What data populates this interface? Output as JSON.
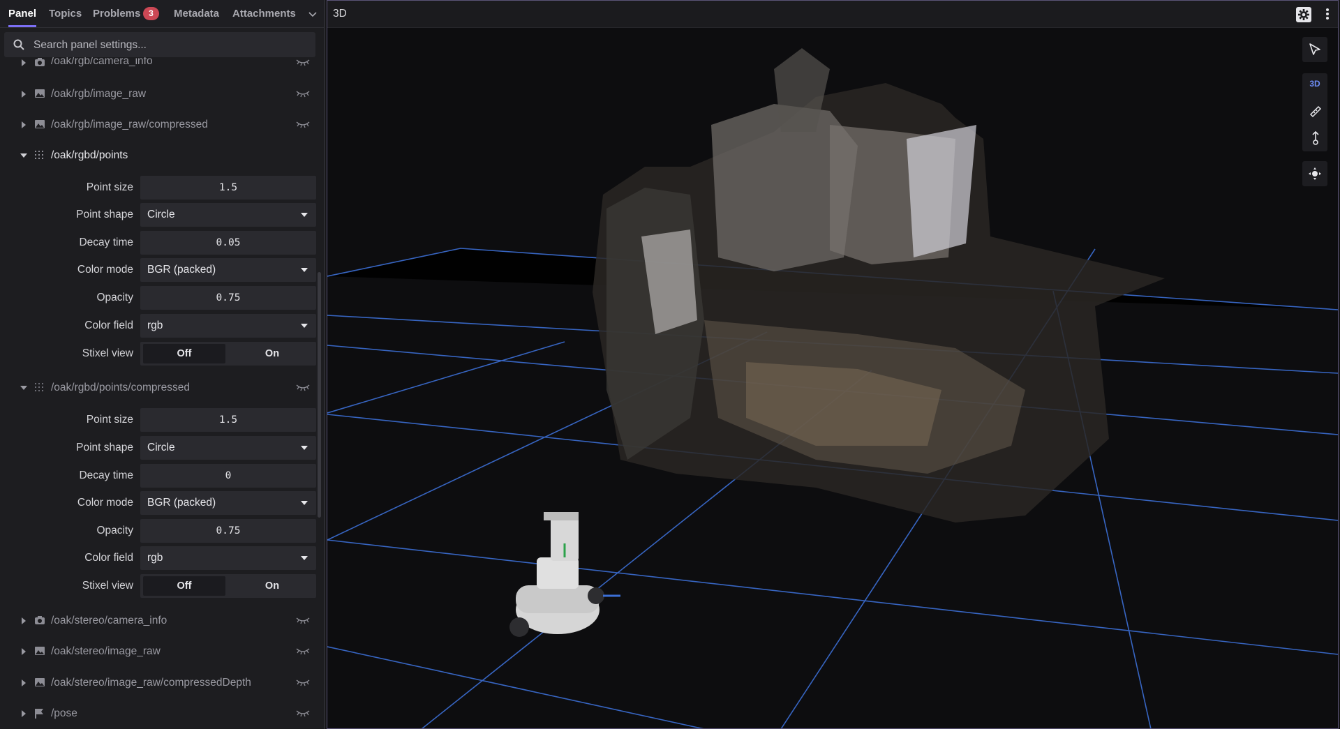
{
  "tabs": [
    {
      "label": "Panel"
    },
    {
      "label": "Topics"
    },
    {
      "label": "Problems",
      "badge": "3"
    },
    {
      "label": "Metadata"
    },
    {
      "label": "Attachments"
    }
  ],
  "search": {
    "placeholder": "Search panel settings..."
  },
  "topics": {
    "camera_info_top": "/oak/rgb/camera_info",
    "image_raw": "/oak/rgb/image_raw",
    "image_raw_compressed": "/oak/rgb/image_raw/compressed",
    "points": "/oak/rgbd/points",
    "points_compressed": "/oak/rgbd/points/compressed",
    "stereo_camera_info": "/oak/stereo/camera_info",
    "stereo_image_raw": "/oak/stereo/image_raw",
    "stereo_compressed_depth": "/oak/stereo/image_raw/compressedDepth",
    "pose": "/pose"
  },
  "labels": {
    "point_size": "Point size",
    "point_shape": "Point shape",
    "decay_time": "Decay time",
    "color_mode": "Color mode",
    "opacity": "Opacity",
    "color_field": "Color field",
    "stixel_view": "Stixel view",
    "off": "Off",
    "on": "On"
  },
  "points_settings": {
    "point_size": "1.5",
    "point_shape": "Circle",
    "decay_time": "0.05",
    "color_mode": "BGR (packed)",
    "opacity": "0.75",
    "color_field": "rgb",
    "stixel_view": "Off"
  },
  "points_compressed_settings": {
    "point_size": "1.5",
    "point_shape": "Circle",
    "decay_time": "0",
    "color_mode": "BGR (packed)",
    "opacity": "0.75",
    "color_field": "rgb",
    "stixel_view": "Off"
  },
  "viewport": {
    "title": "3D",
    "mode_label": "3D"
  },
  "colors": {
    "accent": "#7c6ff5",
    "badge": "#cc4855",
    "grid": "#3c6fd6",
    "mode_3d": "#6d8cf5"
  },
  "icons": [
    "search-icon",
    "chevron-down-icon",
    "camera-icon",
    "image-icon",
    "grid-icon",
    "flag-icon",
    "visibility-icon",
    "settings-icon",
    "more-vertical-icon",
    "select-pointer-icon",
    "ruler-icon",
    "publish-pose-icon",
    "recenter-icon"
  ]
}
